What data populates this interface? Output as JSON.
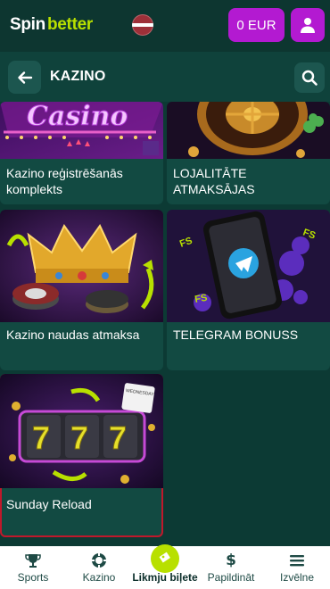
{
  "header": {
    "logo_part1": "Spin",
    "logo_part2": "better",
    "balance_label": "0 EUR",
    "icons": [
      "latvia-flag-icon",
      "user-icon"
    ],
    "accent_color": "#b31ad1",
    "brand_color": "#b8e000"
  },
  "section": {
    "title": "KAZINO",
    "icons": [
      "arrow-left-icon",
      "search-icon"
    ]
  },
  "promos": [
    {
      "label": "Kazino reģistrēšanās komplekts"
    },
    {
      "label": "LOJALITĀTE ATMAKSĀJAS"
    },
    {
      "label": "Kazino naudas atmaksa"
    },
    {
      "label": "TELEGRAM BONUSS"
    },
    {
      "label": "Sunday Reload"
    }
  ],
  "promo_images": {
    "casino_sign": "Casino",
    "calendar": "WEDNESDAY",
    "fs_badge": "FS",
    "slot_digit": "7"
  },
  "bottom_nav": [
    {
      "label": "Sports",
      "icon": "trophy-icon"
    },
    {
      "label": "Kazino",
      "icon": "poker-chip-icon"
    },
    {
      "label": "Likmju biļete",
      "icon": "ticket-icon",
      "active": true
    },
    {
      "label": "Papildināt",
      "icon": "dollar-icon"
    },
    {
      "label": "Izvēlne",
      "icon": "menu-icon"
    }
  ]
}
